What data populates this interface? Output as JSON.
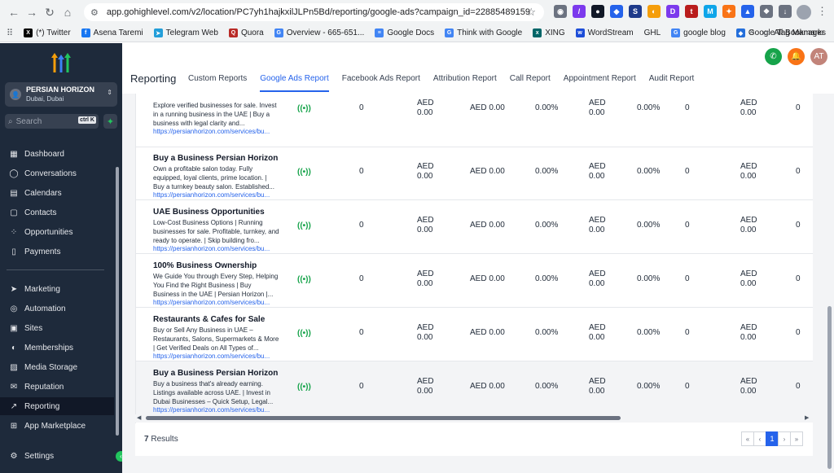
{
  "browser": {
    "url": "app.gohighlevel.com/v2/location/PC7yh1hajkxilJLPn5Bd/reporting/google-ads?campaign_id=22885489159",
    "extensions": [
      {
        "icon": "camera-icon",
        "color": "#6b7280",
        "glyph": "◉"
      },
      {
        "icon": "pen-icon",
        "color": "#7c3aed",
        "glyph": "/"
      },
      {
        "icon": "circle-ext-icon",
        "color": "#111827",
        "glyph": "●"
      },
      {
        "icon": "tag-ext-icon",
        "color": "#2563eb",
        "glyph": "◆"
      },
      {
        "icon": "s-ext-icon",
        "color": "#1e3a8a",
        "glyph": "S"
      },
      {
        "icon": "half-ext-icon",
        "color": "#f59e0b",
        "glyph": "◐"
      },
      {
        "icon": "d-ext-icon",
        "color": "#7c3aed",
        "glyph": "D"
      },
      {
        "icon": "title-ext-icon",
        "color": "#b91c1c",
        "glyph": "t"
      },
      {
        "icon": "m-ext-icon",
        "color": "#0ea5e9",
        "glyph": "M"
      },
      {
        "icon": "fox-ext-icon",
        "color": "#f97316",
        "glyph": "✦"
      },
      {
        "icon": "drop-ext-icon",
        "color": "#2563eb",
        "glyph": "▲"
      },
      {
        "icon": "puzzle-icon",
        "color": "#6b7280",
        "glyph": "❖"
      },
      {
        "icon": "download-icon",
        "color": "#6b7280",
        "glyph": "↓"
      }
    ]
  },
  "bookmarks": {
    "items": [
      {
        "label": "(*) Twitter",
        "icon": "x-icon",
        "color": "#000000",
        "glyph": "X"
      },
      {
        "label": "Asena Taremi",
        "icon": "facebook-icon",
        "color": "#1877f2",
        "glyph": "f"
      },
      {
        "label": "Telegram Web",
        "icon": "telegram-icon",
        "color": "#229ed9",
        "glyph": "➤"
      },
      {
        "label": "Quora",
        "icon": "quora-icon",
        "color": "#b92b27",
        "glyph": "Q"
      },
      {
        "label": "Overview - 665-651...",
        "icon": "google-icon",
        "color": "#4285f4",
        "glyph": "G"
      },
      {
        "label": "Google Docs",
        "icon": "docs-icon",
        "color": "#4285f4",
        "glyph": "≡"
      },
      {
        "label": "Think with Google",
        "icon": "google-icon",
        "color": "#4285f4",
        "glyph": "G"
      },
      {
        "label": "XING",
        "icon": "xing-icon",
        "color": "#006567",
        "glyph": "x"
      },
      {
        "label": "WordStream",
        "icon": "wordstream-icon",
        "color": "#1d4ed8",
        "glyph": "w"
      },
      {
        "label": "GHL",
        "icon": "none",
        "color": "#f1f3f4",
        "glyph": ""
      },
      {
        "label": "google blog",
        "icon": "google-icon",
        "color": "#4285f4",
        "glyph": "G"
      },
      {
        "label": "Google Tag Manager",
        "icon": "gtm-icon",
        "color": "#246fdb",
        "glyph": "◆"
      }
    ],
    "more": "»",
    "all_label": "All Bookmarks"
  },
  "sidebar": {
    "location_name": "PERSIAN HORIZON",
    "location_city": "Dubai, Dubai",
    "search_placeholder": "Search",
    "search_shortcut": "ctrl K",
    "items_top": [
      {
        "label": "Dashboard",
        "icon": "dashboard-icon",
        "glyph": "▦"
      },
      {
        "label": "Conversations",
        "icon": "chat-icon",
        "glyph": "◯"
      },
      {
        "label": "Calendars",
        "icon": "calendar-icon",
        "glyph": "▤"
      },
      {
        "label": "Contacts",
        "icon": "contacts-icon",
        "glyph": "▢"
      },
      {
        "label": "Opportunities",
        "icon": "opportunities-icon",
        "glyph": "⁘"
      },
      {
        "label": "Payments",
        "icon": "payments-icon",
        "glyph": "▯"
      }
    ],
    "items_bottom": [
      {
        "label": "Marketing",
        "icon": "send-icon",
        "glyph": "➤"
      },
      {
        "label": "Automation",
        "icon": "automation-icon",
        "glyph": "◎"
      },
      {
        "label": "Sites",
        "icon": "sites-icon",
        "glyph": "▣"
      },
      {
        "label": "Memberships",
        "icon": "memberships-icon",
        "glyph": "◐"
      },
      {
        "label": "Media Storage",
        "icon": "media-icon",
        "glyph": "▨"
      },
      {
        "label": "Reputation",
        "icon": "reputation-icon",
        "glyph": "✉"
      },
      {
        "label": "Reporting",
        "icon": "reporting-icon",
        "glyph": "↗"
      },
      {
        "label": "App Marketplace",
        "icon": "marketplace-icon",
        "glyph": "⊞"
      }
    ],
    "settings_label": "Settings",
    "active": "Reporting"
  },
  "header": {
    "title": "Reporting",
    "tabs": [
      "Custom Reports",
      "Google Ads Report",
      "Facebook Ads Report",
      "Attribution Report",
      "Call Report",
      "Appointment Report",
      "Audit Report"
    ],
    "active_tab": "Google Ads Report",
    "avatar_initials": "AT",
    "colors": {
      "phone": "#16a34a",
      "bell": "#f97316",
      "avatar": "#c2847a",
      "accent": "#2563eb"
    }
  },
  "table": {
    "rows": [
      {
        "title": "",
        "description": "Explore verified businesses for sale. Invest in a running business in the UAE | Buy a business with legal clarity and...",
        "url": "https://persianhorizon.com/services/bu...",
        "cols": [
          "0",
          "AED\n0.00",
          "AED 0.00",
          "0.00%",
          "AED\n0.00",
          "0.00%",
          "0",
          "AED\n0.00",
          "0"
        ]
      },
      {
        "title": "Buy a Business Persian Horizon",
        "description": "Own a profitable salon today. Fully equipped, loyal clients, prime location. | Buy a turnkey beauty salon. Established...",
        "url": "https://persianhorizon.com/services/bu...",
        "cols": [
          "0",
          "AED\n0.00",
          "AED 0.00",
          "0.00%",
          "AED\n0.00",
          "0.00%",
          "0",
          "AED\n0.00",
          "0"
        ]
      },
      {
        "title": "UAE Business Opportunities",
        "description": "Low-Cost Business Options | Running businesses for sale. Profitable, turnkey, and ready to operate. | Skip building fro...",
        "url": "https://persianhorizon.com/services/bu...",
        "cols": [
          "0",
          "AED\n0.00",
          "AED 0.00",
          "0.00%",
          "AED\n0.00",
          "0.00%",
          "0",
          "AED\n0.00",
          "0"
        ]
      },
      {
        "title": "100% Business Ownership",
        "description": "We Guide You through Every Step, Helping You Find the Right Business | Buy Business in the UAE | Persian Horizon |...",
        "url": "https://persianhorizon.com/services/bu...",
        "cols": [
          "0",
          "AED\n0.00",
          "AED 0.00",
          "0.00%",
          "AED\n0.00",
          "0.00%",
          "0",
          "AED\n0.00",
          "0"
        ]
      },
      {
        "title": "Restaurants & Cafes for Sale",
        "description": "Buy or Sell Any Business in UAE – Restaurants, Salons, Supermarkets & More | Get Verified Deals on All Types of...",
        "url": "https://persianhorizon.com/services/bu...",
        "cols": [
          "0",
          "AED\n0.00",
          "AED 0.00",
          "0.00%",
          "AED\n0.00",
          "0.00%",
          "0",
          "AED\n0.00",
          "0"
        ]
      },
      {
        "title": "Buy a Business Persian Horizon",
        "description": "Buy a business that's already earning. Listings available across UAE. | Invest in Dubai Businesses – Quick Setup, Legal...",
        "url": "https://persianhorizon.com/services/bu...",
        "cols": [
          "0",
          "AED\n0.00",
          "AED 0.00",
          "0.00%",
          "AED\n0.00",
          "0.00%",
          "0",
          "AED\n0.00",
          "0"
        ]
      }
    ],
    "status_glyph": "((•))",
    "status_color": "#16a34a"
  },
  "footer": {
    "results_count": "7",
    "results_label": "Results",
    "pager": [
      "«",
      "‹",
      "1",
      "›",
      "»"
    ],
    "current_page": "1"
  }
}
